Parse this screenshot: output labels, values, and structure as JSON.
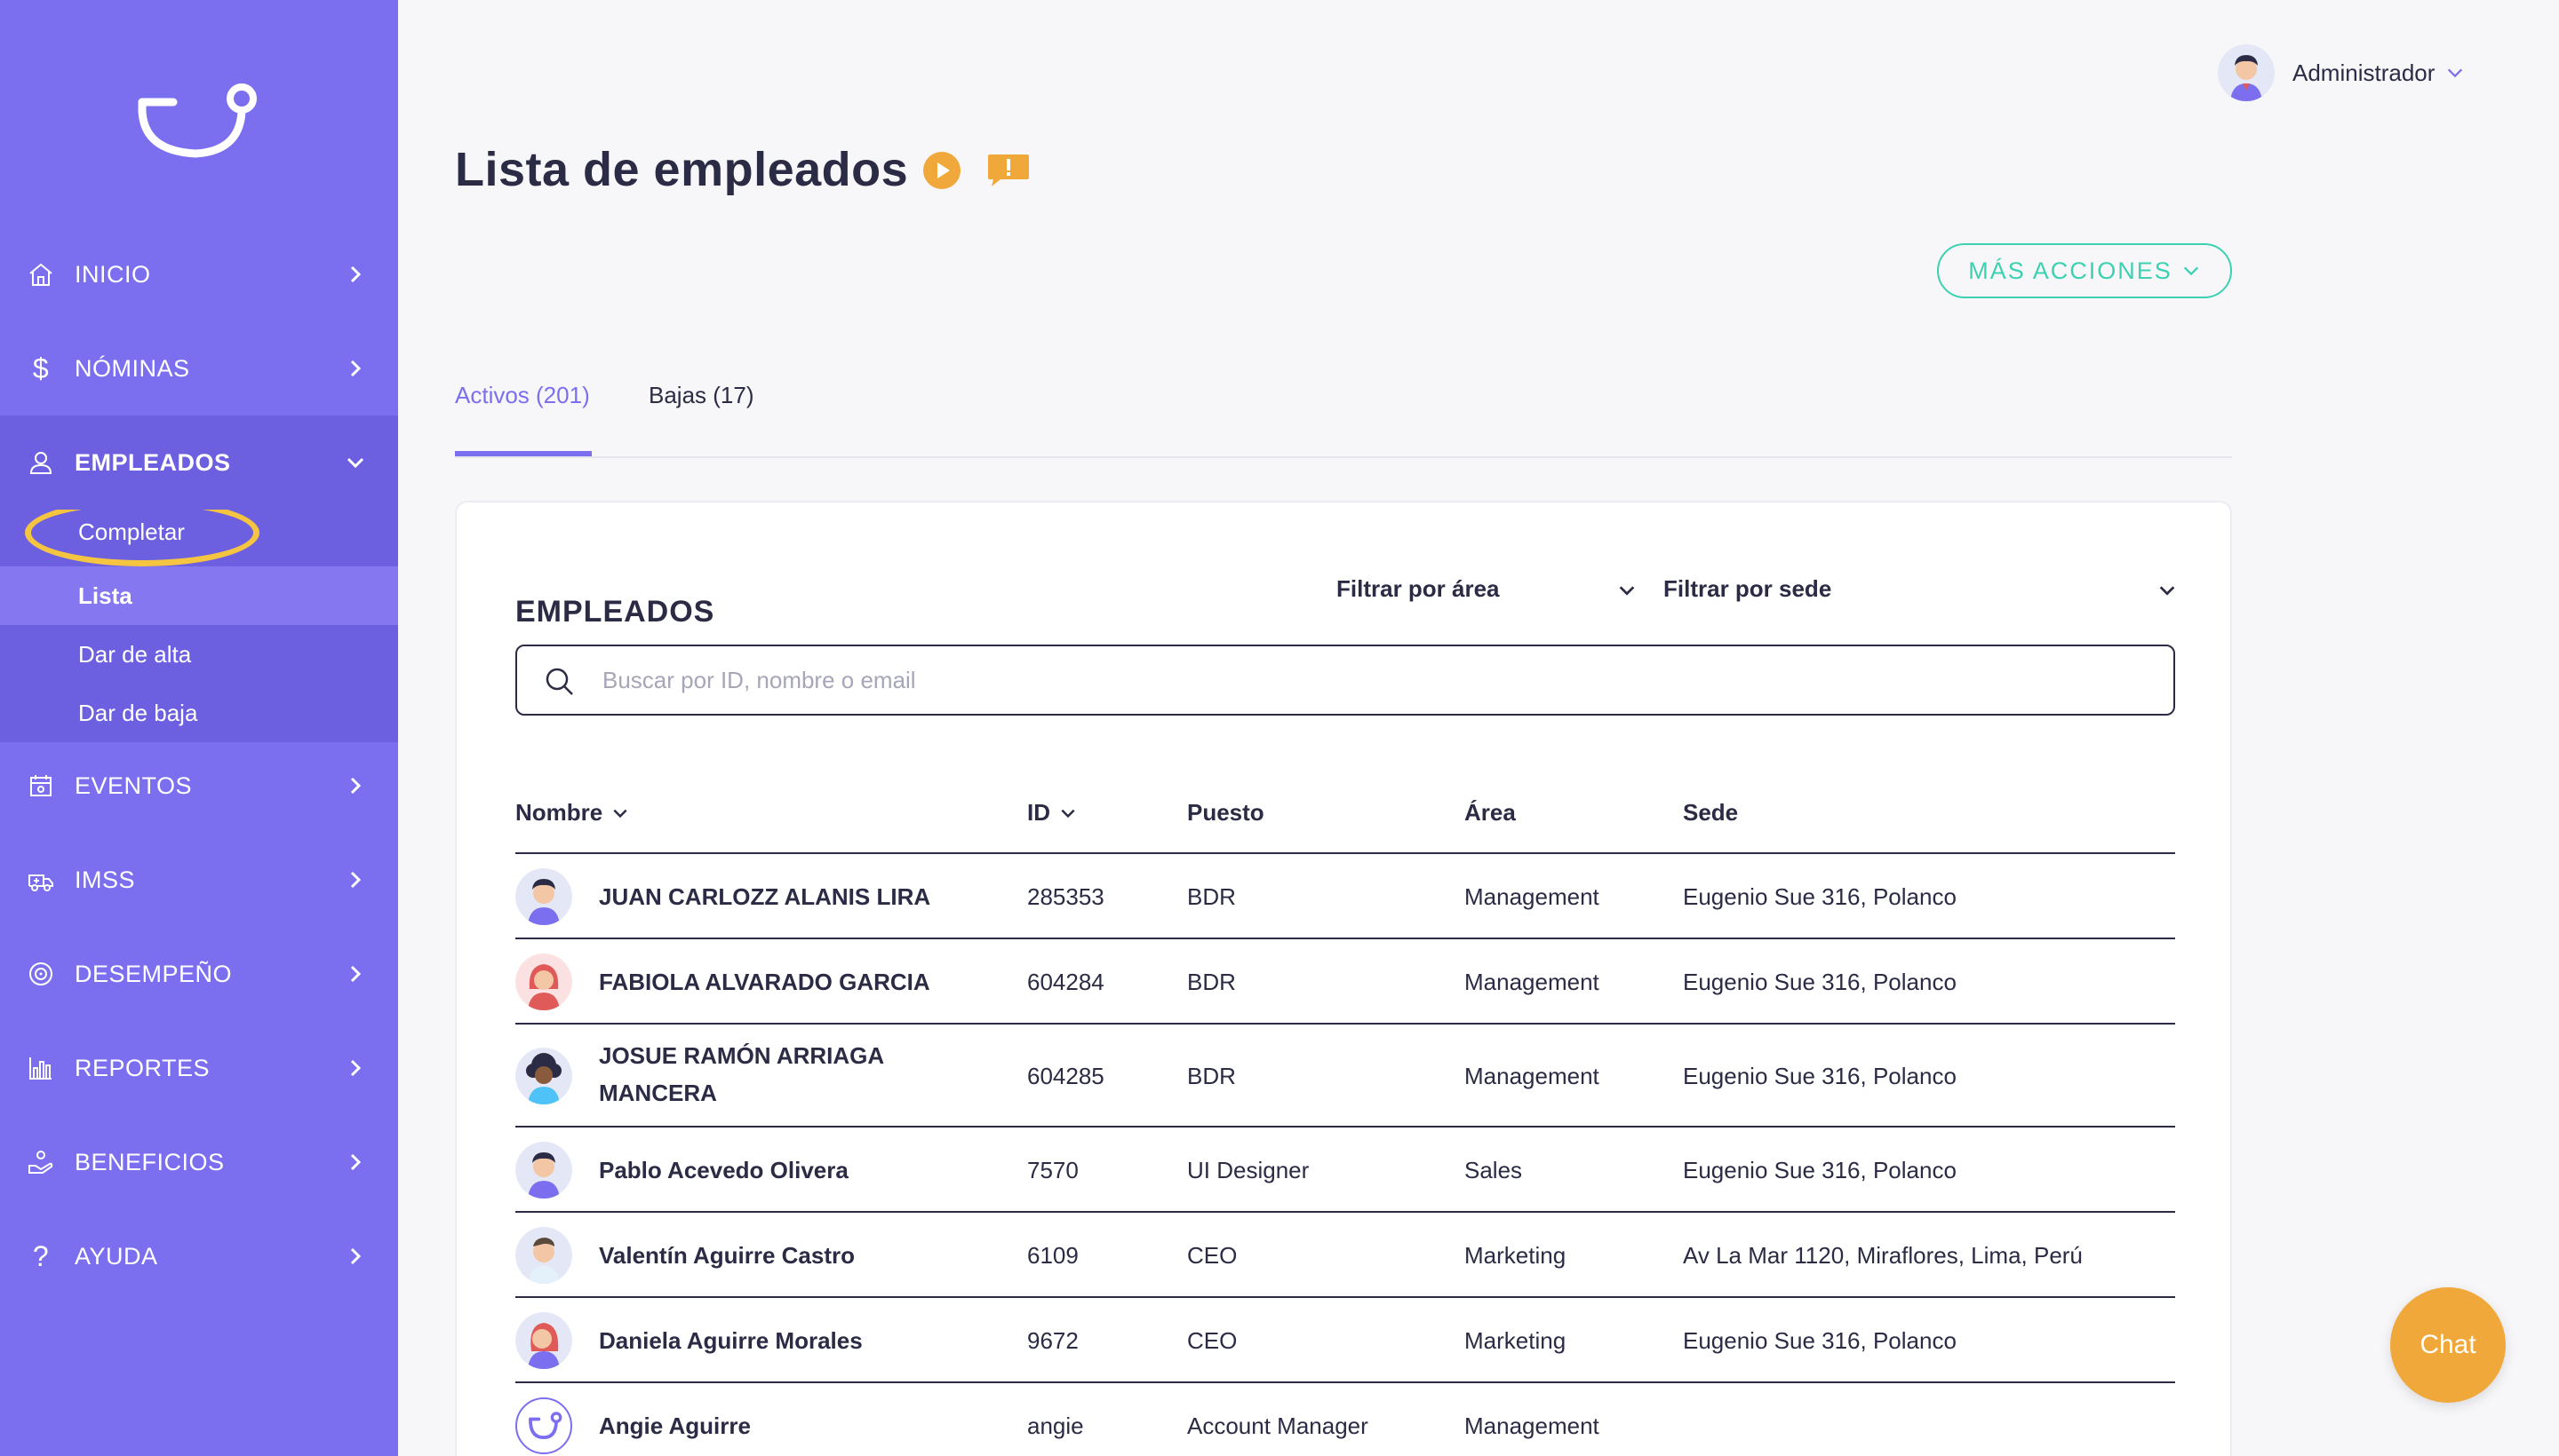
{
  "sidebar": {
    "logo_icon": "brand-smile-logo",
    "items": [
      {
        "label": "INICIO",
        "icon": "home-icon"
      },
      {
        "label": "NÓMINAS",
        "icon": "dollar-icon"
      },
      {
        "label": "EMPLEADOS",
        "icon": "user-icon"
      },
      {
        "label": "EVENTOS",
        "icon": "calendar-icon"
      },
      {
        "label": "IMSS",
        "icon": "ambulance-icon"
      },
      {
        "label": "DESEMPEÑO",
        "icon": "target-icon"
      },
      {
        "label": "REPORTES",
        "icon": "bar-chart-icon"
      },
      {
        "label": "BENEFICIOS",
        "icon": "hand-gift-icon"
      },
      {
        "label": "AYUDA",
        "icon": "question-icon"
      }
    ],
    "sub_items": [
      {
        "label": "Completar"
      },
      {
        "label": "Lista"
      },
      {
        "label": "Dar de alta"
      },
      {
        "label": "Dar de baja"
      }
    ]
  },
  "header": {
    "user_name": "Administrador"
  },
  "page": {
    "title": "Lista de empleados",
    "more_actions": "MÁS ACCIONES",
    "tabs": [
      {
        "label": "Activos (201)"
      },
      {
        "label": "Bajas (17)"
      }
    ]
  },
  "table": {
    "title": "EMPLEADOS",
    "filter_area": "Filtrar por área",
    "filter_sede": "Filtrar por sede",
    "search_placeholder": "Buscar por ID, nombre o email",
    "columns": {
      "name": "Nombre",
      "id": "ID",
      "puesto": "Puesto",
      "area": "Área",
      "sede": "Sede"
    },
    "rows": [
      {
        "name": "JUAN CARLOZZ ALANIS LIRA",
        "id": "285353",
        "puesto": "BDR",
        "area": "Management",
        "sede": "Eugenio Sue 316, Polanco"
      },
      {
        "name": "FABIOLA ALVARADO GARCIA",
        "id": "604284",
        "puesto": "BDR",
        "area": "Management",
        "sede": "Eugenio Sue 316, Polanco"
      },
      {
        "name": "JOSUE RAMÓN ARRIAGA MANCERA",
        "id": "604285",
        "puesto": "BDR",
        "area": "Management",
        "sede": "Eugenio Sue 316, Polanco"
      },
      {
        "name": "Pablo Acevedo Olivera",
        "id": "7570",
        "puesto": "UI Designer",
        "area": "Sales",
        "sede": "Eugenio Sue 316, Polanco"
      },
      {
        "name": "Valentín Aguirre Castro",
        "id": "6109",
        "puesto": "CEO",
        "area": "Marketing",
        "sede": "Av La Mar 1120, Miraflores, Lima, Perú"
      },
      {
        "name": "Daniela Aguirre Morales",
        "id": "9672",
        "puesto": "CEO",
        "area": "Marketing",
        "sede": "Eugenio Sue 316, Polanco"
      },
      {
        "name": "Angie Aguirre",
        "id": "angie",
        "puesto": "Account Manager",
        "area": "Management",
        "sede": ""
      }
    ]
  },
  "chat": {
    "label": "Chat"
  },
  "colors": {
    "sidebar": "#7b6ff0",
    "accent": "#7b6ff0",
    "teal": "#3cd1b0",
    "orange": "#f0a83a",
    "highlight": "#f5c542"
  }
}
